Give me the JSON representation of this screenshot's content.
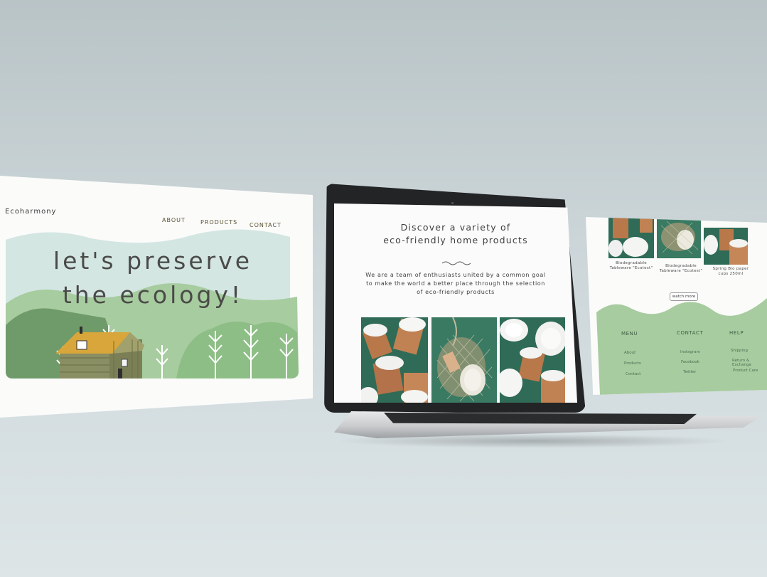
{
  "left_page": {
    "brand": "Ecoharmony",
    "nav": [
      "ABOUT",
      "PRODUCTS",
      "CONTACT"
    ],
    "hero_line1": "let's preserve",
    "hero_line2": "the ecology!"
  },
  "laptop_page": {
    "heading_line1": "Discover a variety of",
    "heading_line2": "eco-friendly home products",
    "body_line1": "We are a team of enthusiasts united by a common goal",
    "body_line2": "to make the world a better place through the selection",
    "body_line3": "of eco-friendly products"
  },
  "right_page": {
    "products": [
      {
        "line1": "Biodegradable",
        "line2": "Tableware \"Ecotest\""
      },
      {
        "line1": "Biodegradable",
        "line2": "Tableware \"Ecotest\""
      },
      {
        "line1": "Spring Bio paper",
        "line2": "cups 250ml"
      }
    ],
    "watch_more": "watch more",
    "footer": {
      "menu": {
        "title": "MENU",
        "links": [
          "About",
          "Products",
          "Contact"
        ]
      },
      "contact": {
        "title": "CONTACT",
        "links": [
          "Instagram",
          "Facebook",
          "Twitter"
        ]
      },
      "help": {
        "title": "HELP",
        "links": [
          "Shipping",
          "Return & Exchange",
          "Product Care"
        ]
      }
    }
  },
  "colors": {
    "sage_light": "#d3e6e2",
    "sage": "#a7cc9f",
    "sage_dark": "#7aab74",
    "forest": "#5d8a5a",
    "mustard": "#d8a63a",
    "teal_photo": "#2f6b57",
    "kraft": "#b9784a"
  }
}
